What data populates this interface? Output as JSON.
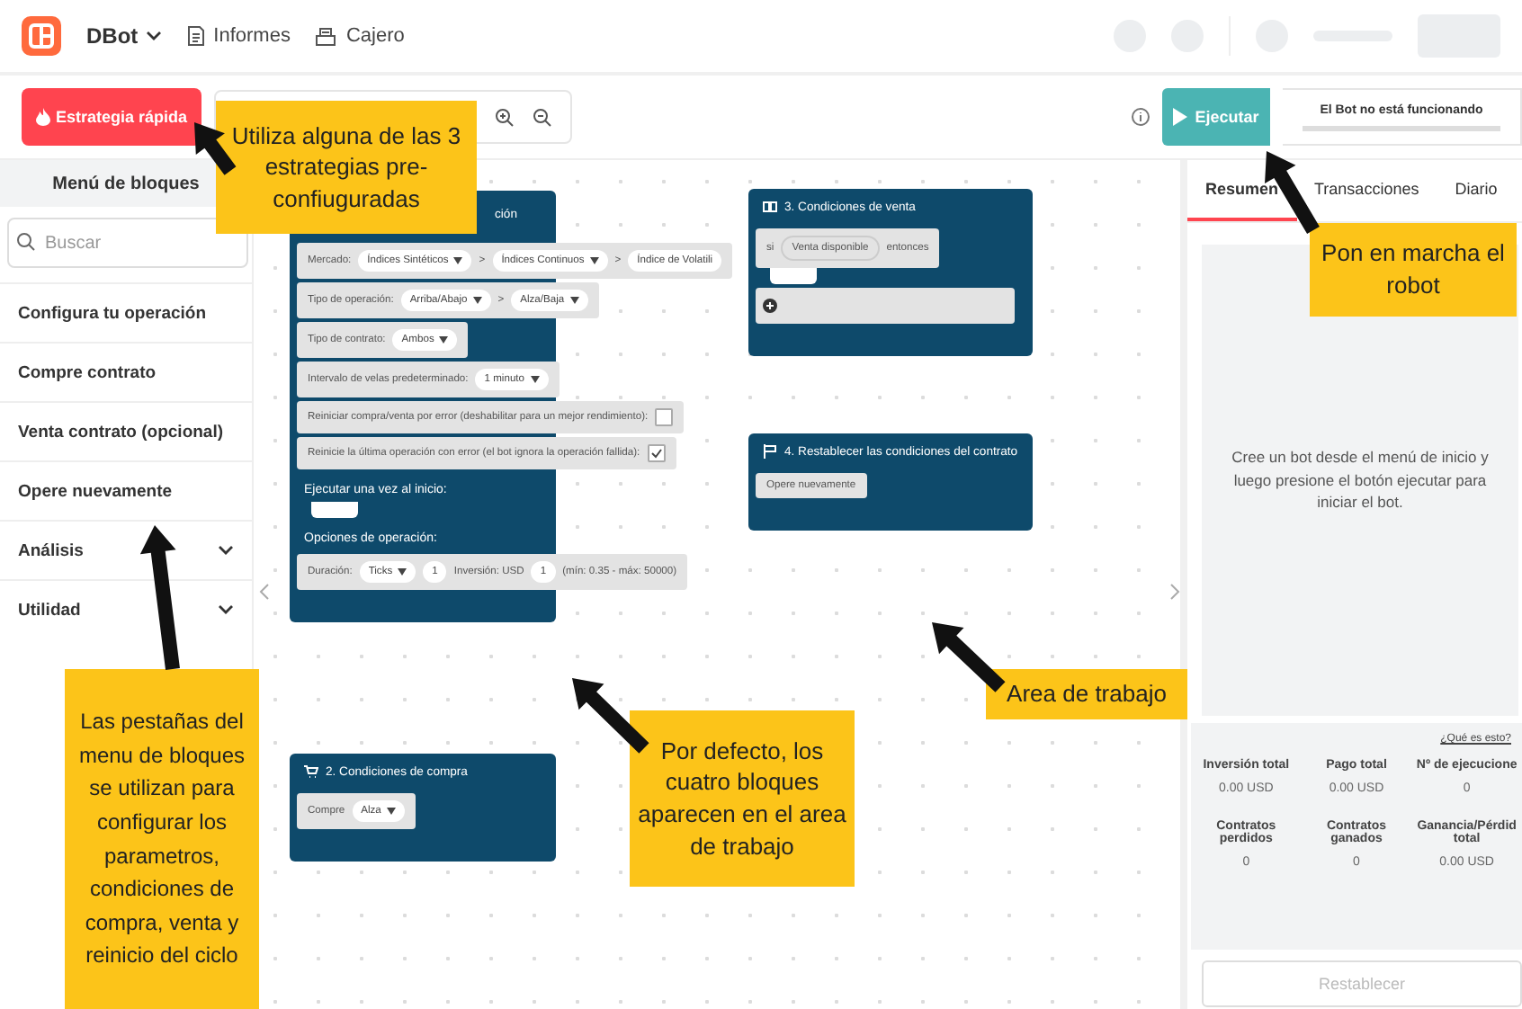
{
  "header": {
    "brand": "DBot",
    "nav": [
      {
        "label": "Informes"
      },
      {
        "label": "Cajero"
      }
    ]
  },
  "toolbar": {
    "quick_strategy": "Estrategia rápida",
    "run_button": "Ejecutar",
    "bot_status": "El Bot no está funcionando"
  },
  "block_menu": {
    "title": "Menú de bloques",
    "search_placeholder": "Buscar",
    "items": [
      {
        "label": "Configura tu operación",
        "kind": "item"
      },
      {
        "label": "Compre contrato",
        "kind": "item"
      },
      {
        "label": "Venta contrato (opcional)",
        "kind": "item"
      },
      {
        "label": "Opere nuevamente",
        "kind": "item"
      },
      {
        "label": "Análisis",
        "kind": "group"
      },
      {
        "label": "Utilidad",
        "kind": "group"
      }
    ]
  },
  "workspace": {
    "blocks": [
      {
        "title": "ción",
        "rows": [
          {
            "kind": "fields",
            "parts": [
              {
                "kind": "label",
                "text": "Mercado:"
              },
              {
                "kind": "dropdown",
                "text": "Índices Sintéticos"
              },
              {
                "kind": "sep",
                "text": ">"
              },
              {
                "kind": "dropdown",
                "text": "Índices Continuos"
              },
              {
                "kind": "sep",
                "text": ">"
              },
              {
                "kind": "value",
                "text": "Índice de Volatili"
              }
            ]
          },
          {
            "kind": "fields",
            "parts": [
              {
                "kind": "label",
                "text": "Tipo de operación:"
              },
              {
                "kind": "dropdown",
                "text": "Arriba/Abajo"
              },
              {
                "kind": "sep",
                "text": ">"
              },
              {
                "kind": "dropdown",
                "text": "Alza/Baja"
              }
            ]
          },
          {
            "kind": "fields",
            "parts": [
              {
                "kind": "label",
                "text": "Tipo de contrato:"
              },
              {
                "kind": "dropdown",
                "text": "Ambos"
              }
            ]
          },
          {
            "kind": "fields",
            "parts": [
              {
                "kind": "label",
                "text": "Intervalo de velas predeterminado:"
              },
              {
                "kind": "dropdown",
                "text": "1 minuto"
              }
            ]
          },
          {
            "kind": "fields",
            "parts": [
              {
                "kind": "label",
                "text": "Reiniciar compra/venta por error (deshabilitar para un mejor rendimiento):"
              },
              {
                "kind": "checkbox",
                "checked": false
              }
            ]
          },
          {
            "kind": "fields",
            "parts": [
              {
                "kind": "label",
                "text": "Reinicie la última operación con error (el bot ignora la operación fallida):"
              },
              {
                "kind": "checkbox",
                "checked": true
              }
            ]
          },
          {
            "kind": "heading",
            "text": "Ejecutar una vez al inicio:"
          },
          {
            "kind": "slot"
          },
          {
            "kind": "heading",
            "text": "Opciones de operación:"
          },
          {
            "kind": "fields",
            "parts": [
              {
                "kind": "label",
                "text": "Duración:"
              },
              {
                "kind": "dropdown",
                "text": "Ticks"
              },
              {
                "kind": "number",
                "text": "1"
              },
              {
                "kind": "label",
                "text": "Inversión: USD"
              },
              {
                "kind": "number",
                "text": "1"
              },
              {
                "kind": "label",
                "text": "(mín: 0.35 - máx: 50000)"
              }
            ]
          }
        ]
      },
      {
        "title": "2. Condiciones de compra",
        "rows": [
          {
            "kind": "fields",
            "parts": [
              {
                "kind": "label",
                "text": "Compre"
              },
              {
                "kind": "dropdown",
                "text": "Alza"
              }
            ]
          }
        ]
      },
      {
        "title": "3. Condiciones de venta",
        "rows": [
          {
            "kind": "fields",
            "parts": [
              {
                "kind": "label",
                "text": "si"
              },
              {
                "kind": "pill",
                "text": "Venta disponible"
              },
              {
                "kind": "label",
                "text": "entonces"
              }
            ]
          },
          {
            "kind": "slot"
          },
          {
            "kind": "add"
          }
        ]
      },
      {
        "title": "4. Restablecer las condiciones del contrato",
        "rows": [
          {
            "kind": "fields",
            "parts": [
              {
                "kind": "label",
                "text": "Opere nuevamente"
              }
            ]
          }
        ]
      }
    ]
  },
  "summary_panel": {
    "tabs": [
      {
        "label": "Resumen",
        "selected": true
      },
      {
        "label": "Transacciones",
        "selected": false
      },
      {
        "label": "Diario",
        "selected": false
      }
    ],
    "empty_message": "Cree un bot desde el menú de inicio y luego presione el botón ejecutar para iniciar el bot.",
    "help_link": "¿Qué es esto?",
    "stats": [
      {
        "label": "Inversión total",
        "value": "0.00 USD"
      },
      {
        "label": "Pago total",
        "value": "0.00 USD"
      },
      {
        "label": "Nº de ejecucione",
        "value": "0"
      },
      {
        "label": "Contratos perdidos",
        "value": "0"
      },
      {
        "label": "Contratos ganados",
        "value": "0"
      },
      {
        "label": "Ganancia/Pérdid total",
        "value": "0.00 USD"
      }
    ],
    "reset_button": {
      "label": "Restablecer",
      "disabled": true
    }
  },
  "callouts": [
    {
      "text": "Utiliza alguna de las 3 estrategias pre-confiuguradas"
    },
    {
      "text": "Pon en marcha el robot"
    },
    {
      "text": "Area de trabajo"
    },
    {
      "text": "Por defecto, los cuatro bloques aparecen en el area de trabajo"
    },
    {
      "text": "Las pestañas del menu de bloques se utilizan para configurar los parametros, condiciones de compra, venta y reinicio del ciclo"
    }
  ]
}
